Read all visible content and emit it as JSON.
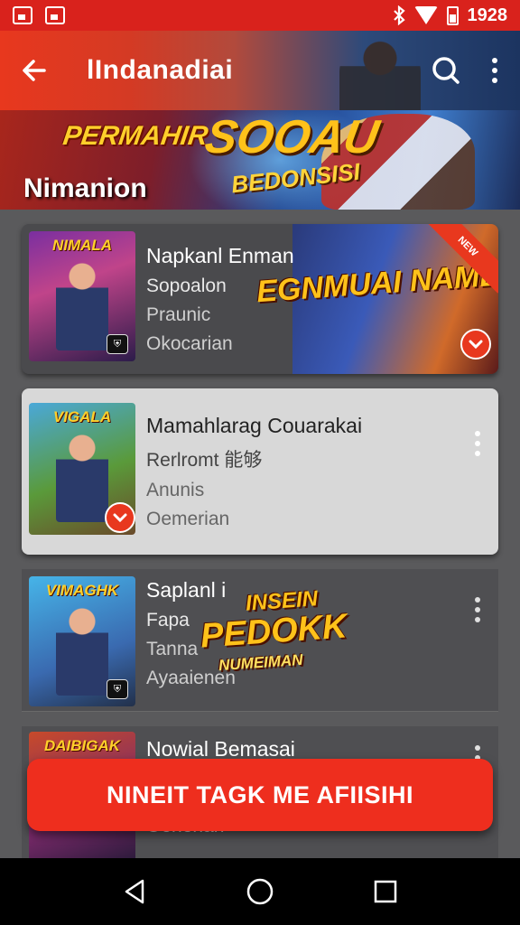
{
  "status_bar": {
    "time": "1928",
    "icons": [
      "image-icon",
      "photo-icon",
      "bluetooth-icon",
      "wifi-icon",
      "battery-icon"
    ]
  },
  "app_bar": {
    "title": "lIndanadiai",
    "back_icon": "arrow-back-icon",
    "search_icon": "search-icon",
    "more_icon": "more-vert-icon"
  },
  "banner": {
    "logo_left": "PERMAHIR",
    "logo_main": "SOOAU",
    "logo_sub": "BEDONSISI",
    "subtitle": "Nimanion"
  },
  "list": [
    {
      "thumb_title": "NIMALA",
      "title": "Napkanl Enman",
      "line1": "Sopoalon",
      "line2": "Praunic",
      "line3": "Okocarian",
      "promo_text": "EGNMUAI NAMEN",
      "ribbon": "NEW"
    },
    {
      "thumb_title": "VIGALA",
      "title": "Mamahlarag Couarakai",
      "line1": "Rerlromt 能够",
      "line2": "Anunis",
      "line3": "Oemerian"
    },
    {
      "thumb_title": "VIMAGHK",
      "title": "Saplanl i",
      "line1": "Fapa",
      "line2": "Tanna",
      "line3": "Ayaaienen",
      "promo_text_1": "INSEIN",
      "promo_text_2": "PEDOKK",
      "promo_text_3": "NUMEIMAN"
    },
    {
      "thumb_title": "DAIBIGAK",
      "title": "Nowial Bemasai",
      "line3": "Oeherian"
    }
  ],
  "cta": {
    "label": "NINEIT TAGK ME AFIISIHI"
  },
  "nav_bar": {
    "back": "nav-back-icon",
    "home": "nav-home-icon",
    "recents": "nav-recents-icon"
  },
  "colors": {
    "accent": "#ee2e1e",
    "status_bar": "#d9221c",
    "background": "#5a5a5c",
    "selected_card": "#d8d8d8"
  }
}
